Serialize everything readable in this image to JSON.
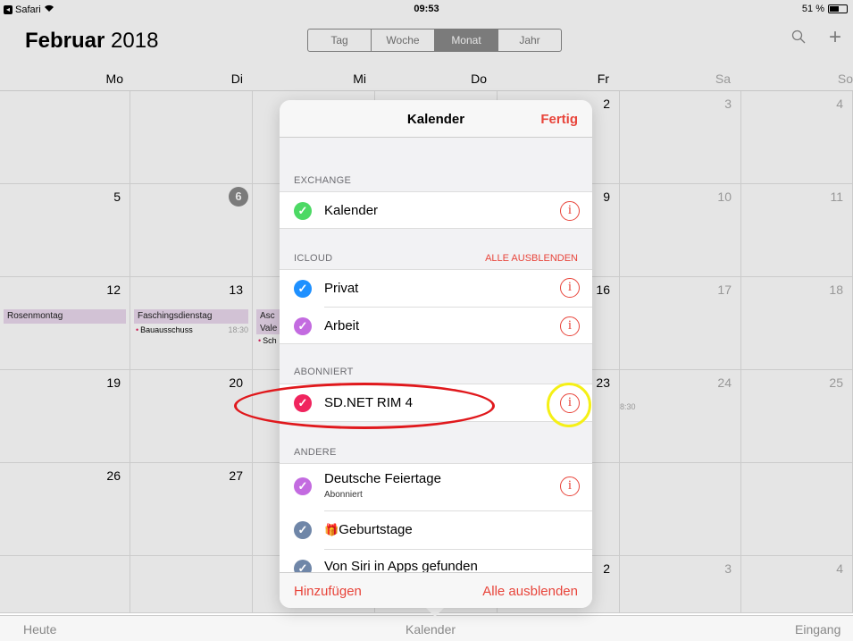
{
  "status": {
    "app": "Safari",
    "time": "09:53",
    "battery": "51 %",
    "battery_level": 0.51
  },
  "header": {
    "month": "Februar",
    "year": "2018",
    "views": [
      "Tag",
      "Woche",
      "Monat",
      "Jahr"
    ],
    "active_view": "Monat",
    "search_icon": "search-icon",
    "add_icon": "plus-icon"
  },
  "weekdays": [
    "Mo",
    "Di",
    "Mi",
    "Do",
    "Fr",
    "Sa",
    "So"
  ],
  "days": {
    "r0": [
      "",
      "",
      "",
      "",
      "2",
      "3",
      "4"
    ],
    "r1": [
      "5",
      "6",
      "",
      "",
      "9",
      "10",
      "11"
    ],
    "r2": [
      "12",
      "13",
      "",
      "",
      "16",
      "17",
      "18"
    ],
    "r3": [
      "19",
      "20",
      "",
      "",
      "23",
      "24",
      "25"
    ],
    "r4": [
      "26",
      "27",
      "",
      "",
      "",
      "",
      ""
    ],
    "r5": [
      "",
      "",
      "",
      "",
      "2",
      "3",
      "4"
    ]
  },
  "events": {
    "rosenmontag": "Rosenmontag",
    "faschingsdienstag": "Faschingsdienstag",
    "bauausschuss": "Bauausschuss",
    "bauausschuss_time": "18:30",
    "asc": "Asc",
    "vale": "Vale",
    "sch": "Sch",
    "fri_time": "8:30"
  },
  "popover": {
    "title": "Kalender",
    "done": "Fertig",
    "sections": {
      "exchange": "EXCHANGE",
      "icloud": "ICLOUD",
      "icloud_action": "ALLE AUSBLENDEN",
      "abonniert": "ABONNIERT",
      "andere": "ANDERE"
    },
    "items": {
      "kalender": "Kalender",
      "privat": "Privat",
      "arbeit": "Arbeit",
      "sdnet": "SD.NET RIM 4",
      "feiertage": "Deutsche Feiertage",
      "feiertage_sub": "Abonniert",
      "geburtstage": "Geburtstage",
      "siri": "Von Siri in Apps gefunden"
    },
    "info_glyph": "i",
    "check_glyph": "✓",
    "gift_glyph": "🎁",
    "add": "Hinzufügen",
    "hide_all": "Alle ausblenden"
  },
  "colors": {
    "accent": "#e8443a",
    "green": "#4cd964",
    "blue": "#1e90ff",
    "purple": "#c36be0",
    "pink": "#f0245e",
    "slate": "#6f86a8",
    "annotation_red": "#e0181c",
    "annotation_yellow": "#f5f016"
  },
  "tabbar": {
    "heute": "Heute",
    "kalender": "Kalender",
    "eingang": "Eingang"
  }
}
